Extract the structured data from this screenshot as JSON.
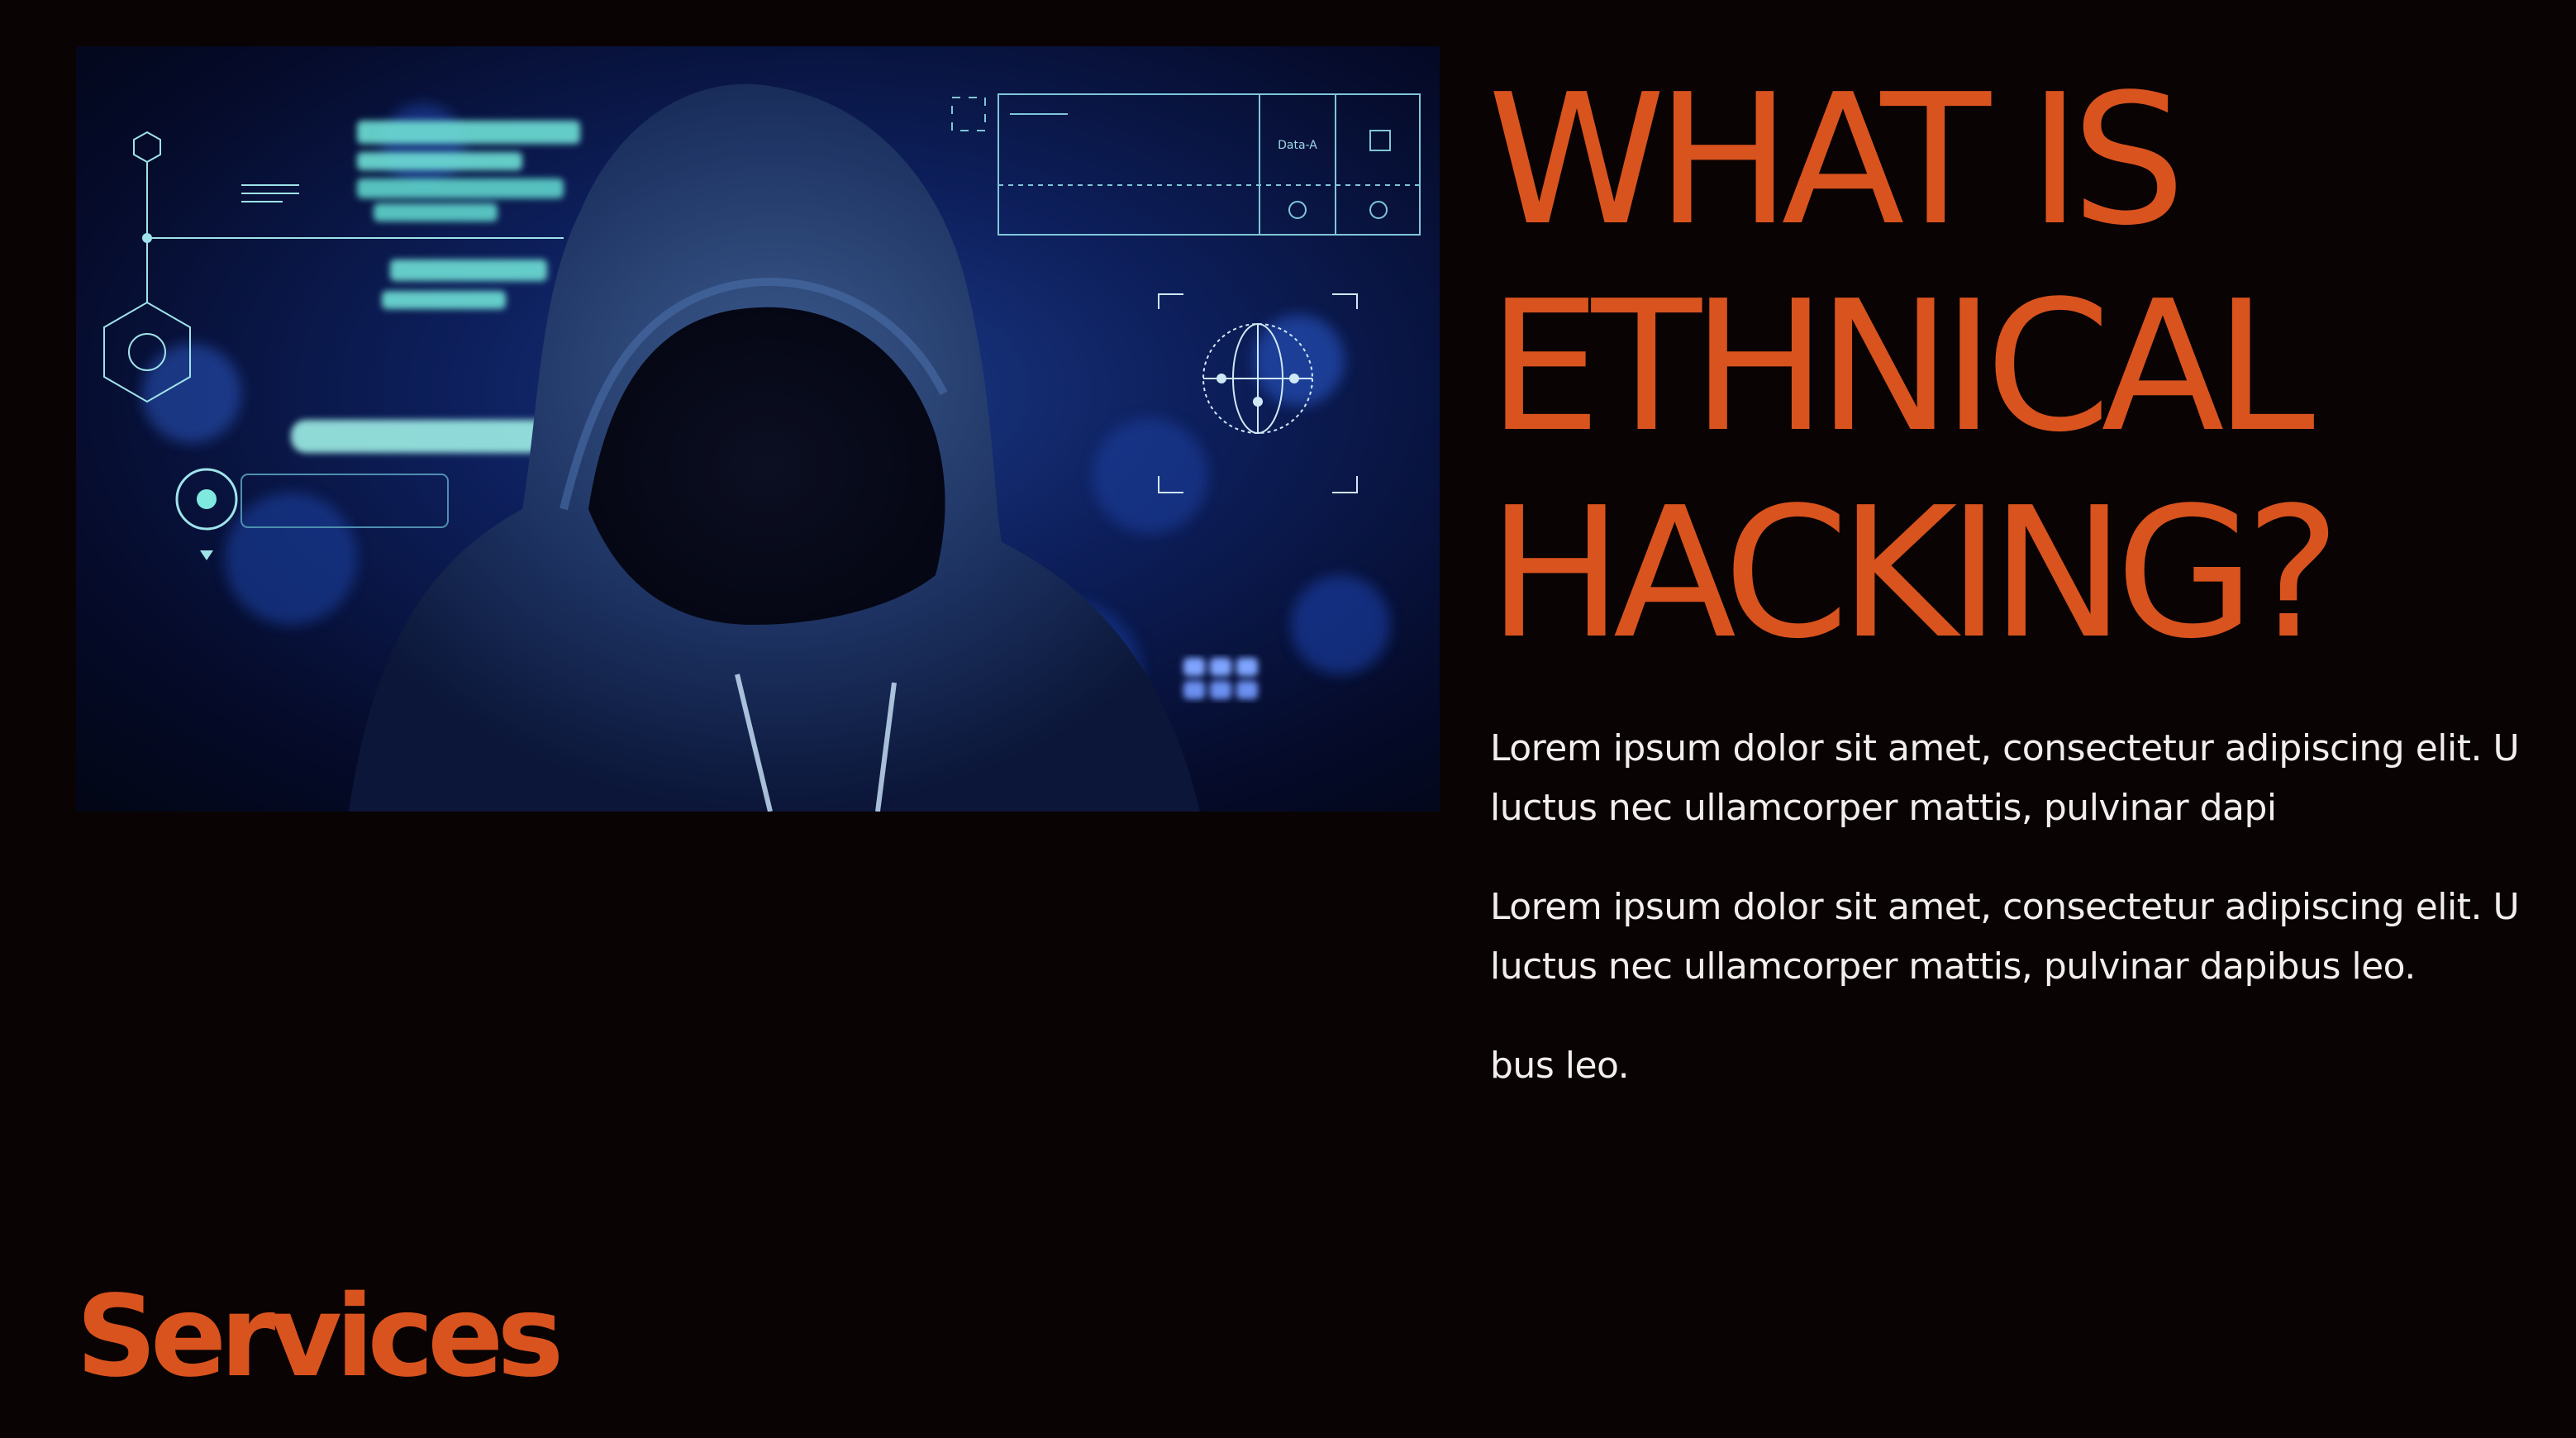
{
  "slide": {
    "title_lines": [
      "WHAT IS",
      "ETHNICAL",
      "HACKING?"
    ],
    "paragraphs": [
      {
        "line1": "Lorem ipsum dolor sit amet, consectetur adipiscing elit. U",
        "line2": "luctus nec ullamcorper mattis, pulvinar dapi"
      },
      {
        "line1": "Lorem ipsum dolor sit amet, consectetur adipiscing elit. U",
        "line2": "luctus nec ullamcorper mattis, pulvinar dapibus leo."
      },
      {
        "line1": "bus leo."
      }
    ],
    "footer_label": "Services",
    "image": {
      "overlay_label": "Data-A",
      "subject": "hooded-hacker-photo"
    }
  },
  "colors": {
    "background": "#0a0303",
    "accent": "#d9531e",
    "body_text": "#f2eeee",
    "hud_cyan": "#7fe9e0"
  }
}
